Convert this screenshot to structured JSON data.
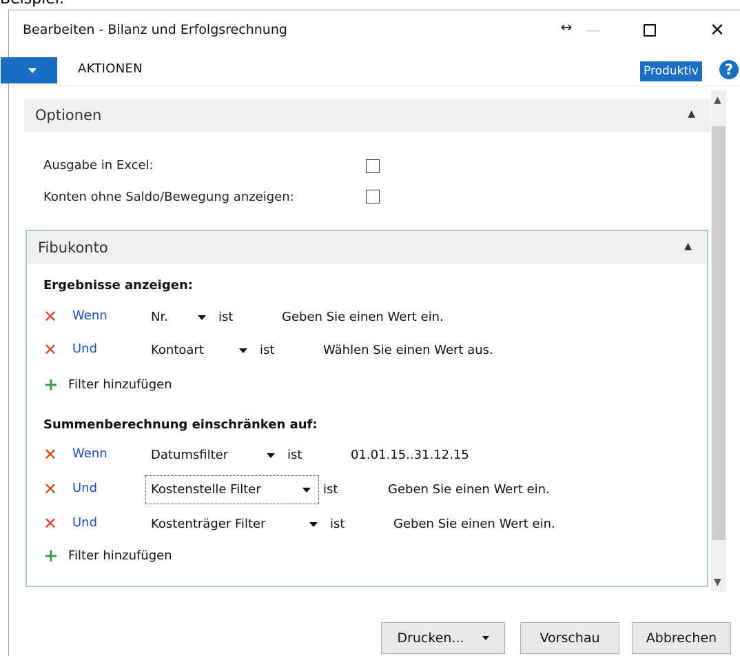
{
  "caption": "Beispiel:",
  "window": {
    "title": "Bearbeiten - Bilanz und Erfolgsrechnung",
    "resize_glyph": "↔",
    "min_glyph": "—",
    "close_glyph": "✕"
  },
  "ribbon": {
    "tab": "AKTIONEN",
    "env_badge": "Produktiv",
    "help": "?"
  },
  "options": {
    "title": "Optionen",
    "rows": [
      {
        "label": "Ausgabe in Excel:",
        "checked": false
      },
      {
        "label": "Konten ohne Saldo/Bewegung anzeigen:",
        "checked": false
      }
    ]
  },
  "fibukonto": {
    "title": "Fibukonto",
    "group1": {
      "title": "Ergebnisse anzeigen:",
      "filters": [
        {
          "conj": "Wenn",
          "field": "Nr.",
          "op": "ist",
          "value": "Geben Sie einen Wert ein."
        },
        {
          "conj": "Und",
          "field": "Kontoart",
          "op": "ist",
          "value": "Wählen Sie einen Wert aus."
        }
      ],
      "add": "Filter hinzufügen"
    },
    "group2": {
      "title": "Summenberechnung einschränken auf:",
      "filters": [
        {
          "conj": "Wenn",
          "field": "Datumsfilter",
          "op": "ist",
          "value": "01.01.15..31.12.15"
        },
        {
          "conj": "Und",
          "field": "Kostenstelle Filter",
          "op": "ist",
          "value": "Geben Sie einen Wert ein."
        },
        {
          "conj": "Und",
          "field": "Kostenträger Filter",
          "op": "ist",
          "value": "Geben Sie einen Wert ein."
        }
      ],
      "add": "Filter hinzufügen"
    }
  },
  "buttons": {
    "print": "Drucken...",
    "preview": "Vorschau",
    "cancel": "Abbrechen"
  },
  "colors": {
    "accent": "#1b6fc2",
    "remove": "#d7421b",
    "add": "#3a9b4b",
    "link": "#1f4fbf"
  }
}
